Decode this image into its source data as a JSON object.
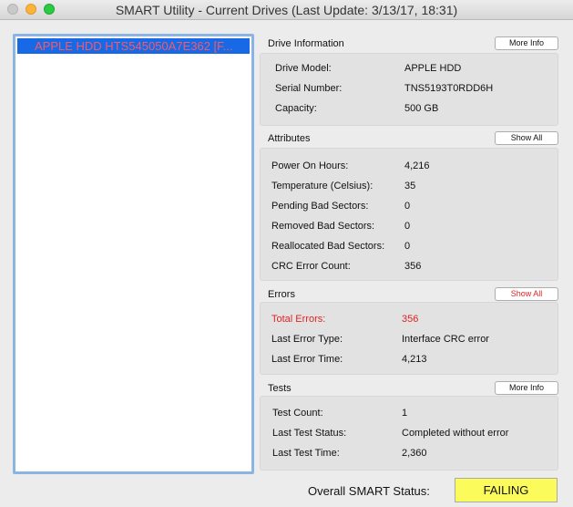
{
  "window": {
    "title": "SMART Utility - Current Drives (Last Update: 3/13/17, 18:31)"
  },
  "drives": [
    {
      "label": "APPLE HDD HTS545050A7E362  [F..."
    }
  ],
  "drive_info": {
    "title": "Drive Information",
    "button": "More Info",
    "rows": [
      {
        "label": "Drive Model:",
        "value": "APPLE HDD"
      },
      {
        "label": "Serial Number:",
        "value": "TNS5193T0RDD6H"
      },
      {
        "label": "Capacity:",
        "value": "500 GB"
      }
    ]
  },
  "attributes": {
    "title": "Attributes",
    "button": "Show All",
    "rows": [
      {
        "label": "Power On Hours:",
        "value": "4,216"
      },
      {
        "label": "Temperature (Celsius):",
        "value": "35"
      },
      {
        "label": "Pending Bad Sectors:",
        "value": "0"
      },
      {
        "label": "Removed Bad Sectors:",
        "value": "0"
      },
      {
        "label": "Reallocated Bad Sectors:",
        "value": "0"
      },
      {
        "label": "CRC Error Count:",
        "value": "356"
      }
    ]
  },
  "errors": {
    "title": "Errors",
    "button": "Show All",
    "rows": [
      {
        "label": "Total Errors:",
        "value": "356"
      },
      {
        "label": "Last Error Type:",
        "value": "Interface CRC error"
      },
      {
        "label": "Last Error Time:",
        "value": "4,213"
      }
    ]
  },
  "tests": {
    "title": "Tests",
    "button": "More Info",
    "rows": [
      {
        "label": "Test Count:",
        "value": "1"
      },
      {
        "label": "Last Test Status:",
        "value": "Completed without error"
      },
      {
        "label": "Last Test Time:",
        "value": "2,360"
      }
    ]
  },
  "status": {
    "label": "Overall SMART Status:",
    "value": "FAILING",
    "color": "#fbfb5b"
  },
  "colors": {
    "error_red": "#e22323",
    "selection_blue": "#1769e6",
    "list_border": "#8ab4e4"
  }
}
